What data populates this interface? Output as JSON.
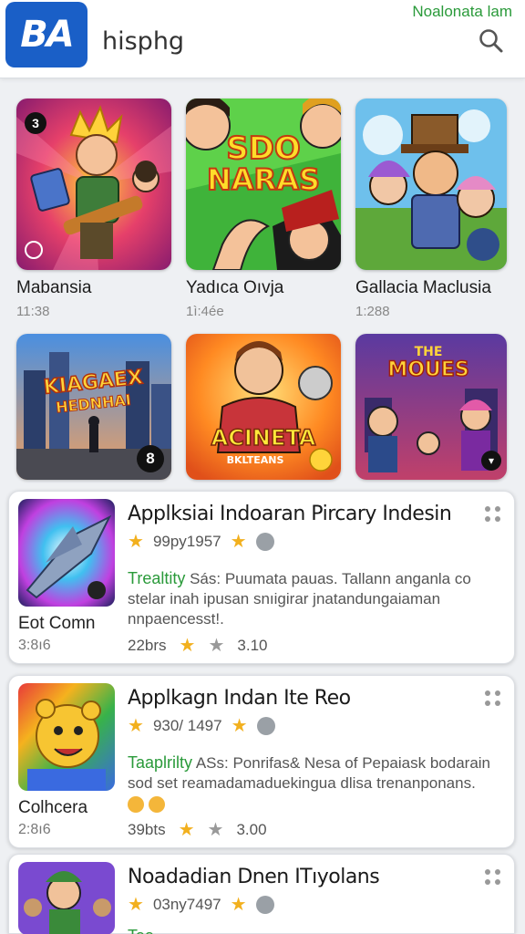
{
  "header": {
    "logo_text": "BA",
    "title": "hisphg",
    "note": "Noalonata lam",
    "search_icon": "search-icon"
  },
  "grid": [
    {
      "name": "Mabansia",
      "meta": "11:38",
      "badge": "3"
    },
    {
      "name": "Yadıca Oıvja",
      "meta": "1ì:4ée",
      "art_text": "SDO NARAS"
    },
    {
      "name": "Gallacia Maclusia",
      "meta": "1:288"
    },
    {
      "art_text": "KIAGAEX HEDNHAI",
      "badge": "8"
    },
    {
      "art_text": "ACINETA",
      "art_subtext": "BKLTEANS"
    },
    {
      "art_text": "THE MOUES"
    }
  ],
  "cards": [
    {
      "title": "Applksiai Indoaran Pircary Indesin",
      "rating": "99py1957",
      "desc_highlight": "Trealtity",
      "desc": "Sás: Puumata pauas. Tallann anganla co stelar inah ipusan snıigirar jnatandungaiaman nnpaencesst!.",
      "stat": "22brs",
      "score": "3.10",
      "label": "Eot Comn",
      "sub": "3:8ı6"
    },
    {
      "title": "Applkagn Indan Ite Reo",
      "rating": "930/ 1497",
      "desc_highlight": "Taaplrilty",
      "desc": "ASs: Ponrifas& Nesa of Pepaiask bodarain sod set reamadamaduekingua dlisa trenanponans.",
      "stat": "39bts",
      "score": "3.00",
      "label": "Colhcera",
      "sub": "2:8ı6"
    },
    {
      "title": "Noadadian Dnen ITıyolans",
      "rating": "03ny7497",
      "desc_highlight": "Taa",
      "desc": "",
      "stat": "",
      "score": "",
      "label": "",
      "sub": ""
    }
  ],
  "colors": {
    "brand": "#1a5fc7",
    "accent_green": "#2a9a3a",
    "star": "#f2b01e"
  }
}
